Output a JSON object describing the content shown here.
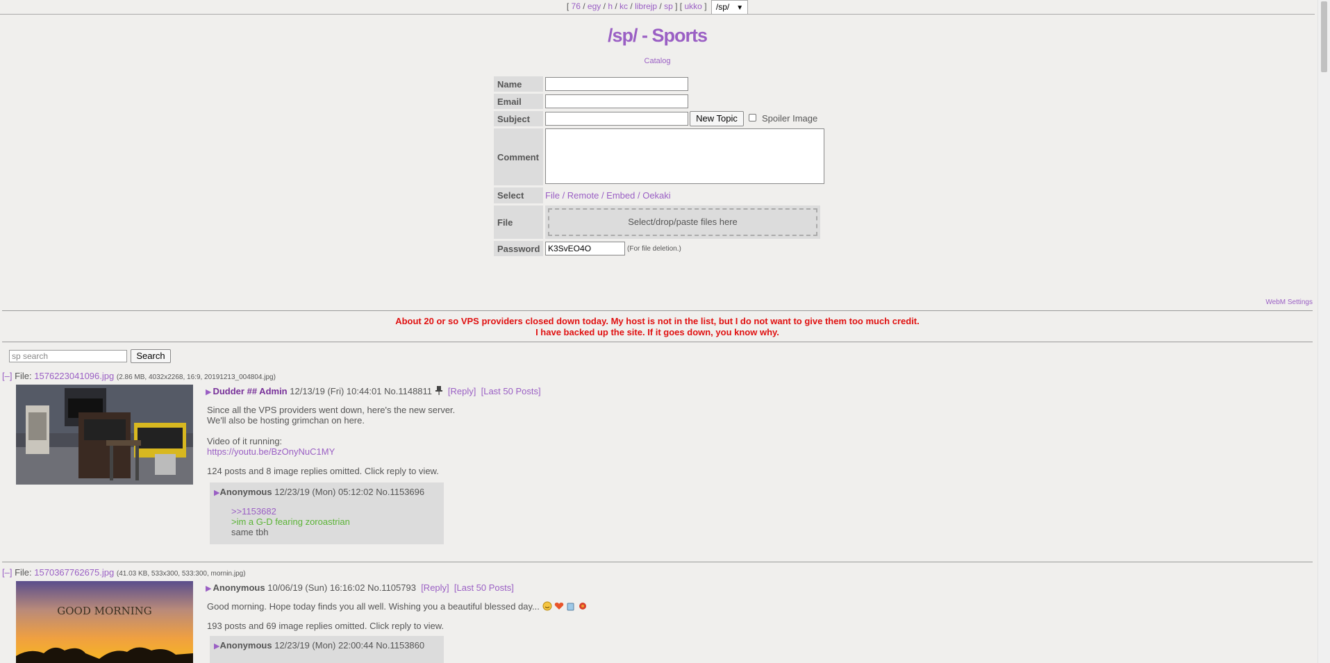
{
  "nav": {
    "open_bracket": "[",
    "boards_a": [
      "76",
      "egy",
      "h",
      "kc",
      "librejp",
      "sp"
    ],
    "mid_bracket": "] [",
    "boards_b": [
      "ukko"
    ],
    "close_bracket": "]",
    "selector_value": "/sp/"
  },
  "header": {
    "title": "/sp/ - Sports",
    "catalog_link": "Catalog"
  },
  "form": {
    "name_label": "Name",
    "email_label": "Email",
    "subject_label": "Subject",
    "new_topic_button": "New Topic",
    "spoiler_label": "Spoiler Image",
    "comment_label": "Comment",
    "select_label": "Select",
    "select_options": [
      "File",
      "Remote",
      "Embed",
      "Oekaki"
    ],
    "select_separator": " / ",
    "file_label": "File",
    "dropzone_text": "Select/drop/paste files here",
    "password_label": "Password",
    "password_value": "K3SvEO4O",
    "password_note": "(For file deletion.)"
  },
  "webm_settings": "WebM Settings",
  "notice": {
    "line1": "About 20 or so VPS providers closed down today. My host is not in the list, but I do not want to give them too much credit.",
    "line2": "I have backed up the site. If it goes down, you know why."
  },
  "search": {
    "placeholder": "sp search",
    "button": "Search"
  },
  "threads": [
    {
      "collapse": "[–]",
      "file_label": "File:",
      "filename": "1576223041096.jpg",
      "filemeta": "(2.86 MB, 4032x2268, 16:9, 20191213_004804.jpg)",
      "name": "Dudder",
      "capcode": "## Admin",
      "date": "12/13/19 (Fri) 10:44:01",
      "no": "No.1148811",
      "reply_link": "[Reply]",
      "last50_link": "[Last 50 Posts]",
      "body_lines": [
        "Since all the VPS providers went down, here's the new server.",
        "We'll also be hosting grimchan on here.",
        "",
        "Video of it running:"
      ],
      "body_link": "https://youtu.be/BzOnyNuC1MY",
      "omitted": "124 posts and 8 image replies omitted. Click reply to view.",
      "reply": {
        "name": "Anonymous",
        "date": "12/23/19 (Mon) 05:12:02",
        "no": "No.1153696",
        "quote_link": ">>1153682",
        "greentext": ">im a G-D fearing zoroastrian",
        "text": "same tbh"
      }
    },
    {
      "collapse": "[–]",
      "file_label": "File:",
      "filename": "1570367762675.jpg",
      "filemeta": "(41.03 KB, 533x300, 533:300, mornin.jpg)",
      "image_caption": "GOOD MORNING",
      "name": "Anonymous",
      "date": "10/06/19 (Sun) 16:16:02",
      "no": "No.1105793",
      "reply_link": "[Reply]",
      "last50_link": "[Last 50 Posts]",
      "body": "Good morning. Hope today finds you all well. Wishing you a beautiful blessed day...",
      "omitted": "193 posts and 69 image replies omitted. Click reply to view.",
      "reply": {
        "name": "Anonymous",
        "date": "12/23/19 (Mon) 22:00:44",
        "no": "No.1153860"
      }
    }
  ]
}
